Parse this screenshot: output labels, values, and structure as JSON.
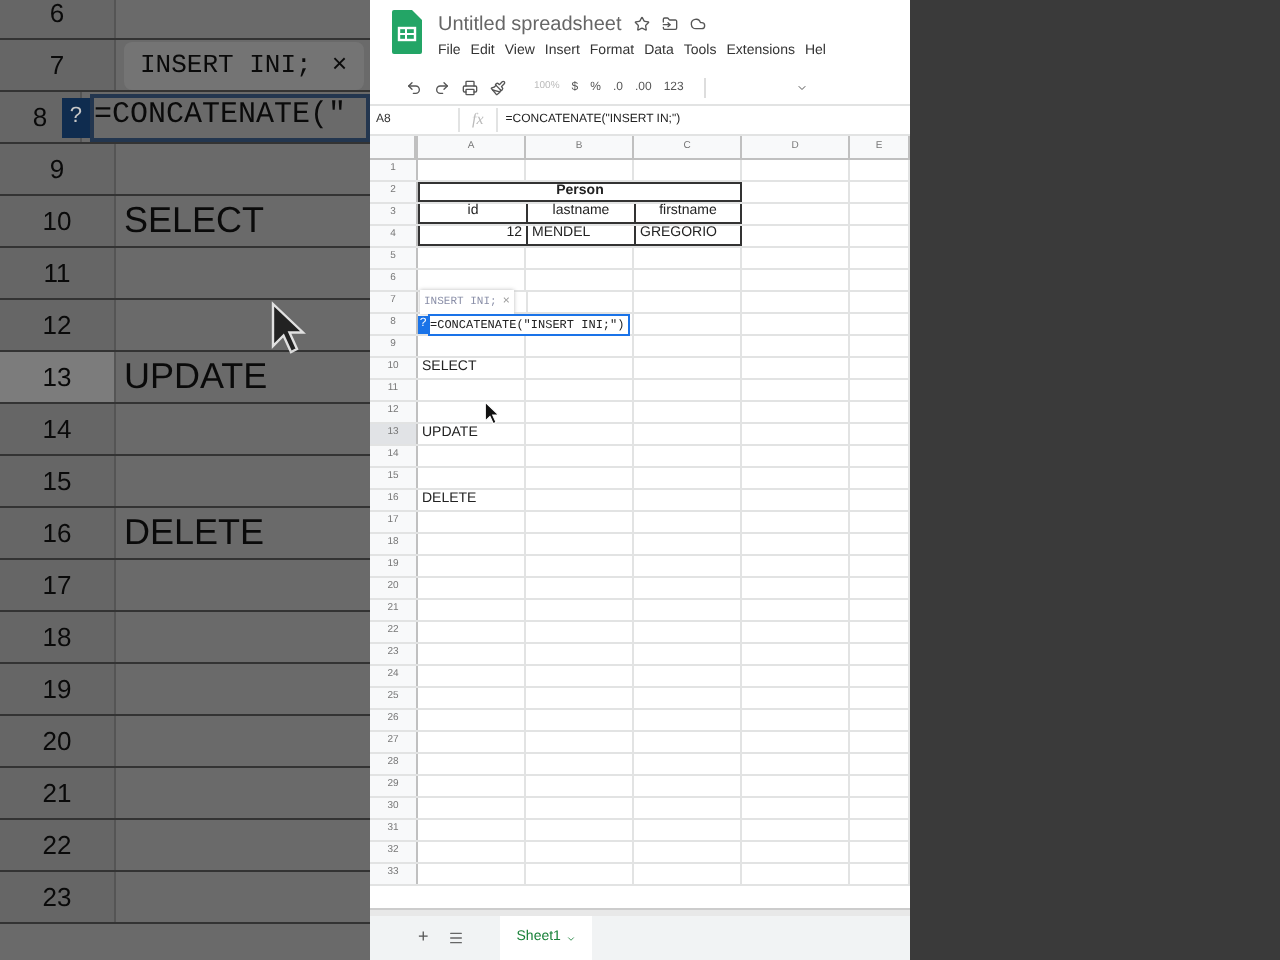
{
  "backdrop": {
    "rows": [
      {
        "number": "6",
        "kind": "blank"
      },
      {
        "number": "7",
        "kind": "hint",
        "text": "INSERT INI;",
        "close": "×"
      },
      {
        "number": "8",
        "kind": "editing",
        "badge": "?",
        "text": "=CONCATENATE(\""
      },
      {
        "number": "9",
        "kind": "blank"
      },
      {
        "number": "10",
        "kind": "text",
        "text": "SELECT"
      },
      {
        "number": "11",
        "kind": "blank"
      },
      {
        "number": "12",
        "kind": "blank"
      },
      {
        "number": "13",
        "kind": "text",
        "text": "UPDATE",
        "highlighted": true
      },
      {
        "number": "14",
        "kind": "blank"
      },
      {
        "number": "15",
        "kind": "blank"
      },
      {
        "number": "16",
        "kind": "text",
        "text": "DELETE"
      },
      {
        "number": "17",
        "kind": "blank"
      },
      {
        "number": "18",
        "kind": "blank"
      },
      {
        "number": "19",
        "kind": "blank"
      },
      {
        "number": "20",
        "kind": "blank"
      },
      {
        "number": "21",
        "kind": "blank"
      },
      {
        "number": "22",
        "kind": "blank"
      },
      {
        "number": "23",
        "kind": "blank"
      }
    ]
  },
  "app": {
    "title": "Untitled spreadsheet",
    "menu": [
      "File",
      "Edit",
      "View",
      "Insert",
      "Format",
      "Data",
      "Tools",
      "Extensions",
      "Hel"
    ],
    "toolbar": {
      "zoom": "100%",
      "currency": "$",
      "percent": "%",
      "decrease_decimals": ".0",
      "increase_decimals": ".00",
      "format": "123"
    },
    "formula_bar": {
      "cell": "A8",
      "fx": "fx",
      "formula": "=CONCATENATE(\"INSERT IN;\")"
    },
    "columns": [
      "A",
      "B",
      "C",
      "D",
      "E"
    ],
    "rows": [
      {
        "number": "1",
        "kind": "blank"
      },
      {
        "number": "2",
        "kind": "table_title",
        "cells": [
          "Person"
        ]
      },
      {
        "number": "3",
        "kind": "table_header",
        "cells": [
          "id",
          "lastname",
          "firstname"
        ]
      },
      {
        "number": "4",
        "kind": "table_row",
        "cells": [
          "12",
          "MENDEL",
          "GREGORIO"
        ]
      },
      {
        "number": "5",
        "kind": "blank"
      },
      {
        "number": "6",
        "kind": "blank"
      },
      {
        "number": "7",
        "kind": "hint",
        "cells": [
          "INSERT INI;",
          "×"
        ]
      },
      {
        "number": "8",
        "kind": "editing",
        "cells": [
          "?",
          "=CONCATENATE(\"INSERT INI;\")"
        ]
      },
      {
        "number": "9",
        "kind": "blank"
      },
      {
        "number": "10",
        "kind": "text",
        "cells": [
          "SELECT"
        ]
      },
      {
        "number": "11",
        "kind": "blank"
      },
      {
        "number": "12",
        "kind": "blank"
      },
      {
        "number": "13",
        "kind": "text",
        "cells": [
          "UPDATE"
        ],
        "highlighted": true
      },
      {
        "number": "14",
        "kind": "blank"
      },
      {
        "number": "15",
        "kind": "blank"
      },
      {
        "number": "16",
        "kind": "text",
        "cells": [
          "DELETE"
        ]
      },
      {
        "number": "17",
        "kind": "blank"
      },
      {
        "number": "18",
        "kind": "blank"
      },
      {
        "number": "19",
        "kind": "blank"
      },
      {
        "number": "20",
        "kind": "blank"
      },
      {
        "number": "21",
        "kind": "blank"
      },
      {
        "number": "22",
        "kind": "blank"
      },
      {
        "number": "23",
        "kind": "blank"
      },
      {
        "number": "24",
        "kind": "blank"
      },
      {
        "number": "25",
        "kind": "blank"
      },
      {
        "number": "26",
        "kind": "blank"
      },
      {
        "number": "27",
        "kind": "blank"
      },
      {
        "number": "28",
        "kind": "blank"
      },
      {
        "number": "29",
        "kind": "blank"
      },
      {
        "number": "30",
        "kind": "blank"
      },
      {
        "number": "31",
        "kind": "blank"
      },
      {
        "number": "32",
        "kind": "blank"
      },
      {
        "number": "33",
        "kind": "blank"
      }
    ],
    "sheet_tabs": {
      "add": "+",
      "tabs": [
        {
          "label": "Sheet1",
          "selected": true
        }
      ]
    }
  }
}
